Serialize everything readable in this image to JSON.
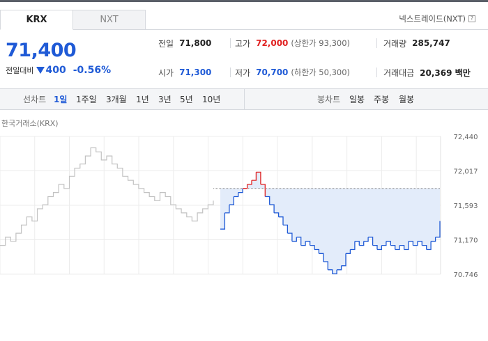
{
  "tabs": [
    {
      "label": "KRX",
      "active": true
    },
    {
      "label": "NXT",
      "active": false
    }
  ],
  "ext_link": {
    "label": "넥스트레이드(NXT)",
    "help_icon": "?"
  },
  "price": {
    "current": "71,400",
    "change_label": "전일대비",
    "direction_icon": "down-triangle-icon",
    "change": "400",
    "change_pct": "-0.56%"
  },
  "stats": {
    "prev_close": {
      "label": "전일",
      "value": "71,800"
    },
    "high": {
      "label": "고가",
      "value": "72,000",
      "limit_text": "(상한가 93,300)"
    },
    "volume": {
      "label": "거래량",
      "value": "285,747"
    },
    "open": {
      "label": "시가",
      "value": "71,300"
    },
    "low": {
      "label": "저가",
      "value": "70,700",
      "limit_text": "(하한가 50,300)"
    },
    "amount": {
      "label": "거래대금",
      "value": "20,369 백만"
    }
  },
  "line_chart_bar": {
    "label": "선차트",
    "periods": [
      "1일",
      "1주일",
      "3개월",
      "1년",
      "3년",
      "5년",
      "10년"
    ],
    "active": "1일"
  },
  "candle_chart_bar": {
    "label": "봉차트",
    "periods": [
      "일봉",
      "주봉",
      "월봉"
    ]
  },
  "colors": {
    "accent_blue": "#1f5ad6",
    "up_red": "#e02020",
    "prev_day_gray": "#c2c2c2",
    "fill_blue": "#e3ecfa"
  },
  "chart_data": {
    "type": "line",
    "title": "한국거래소(KRX)",
    "ylim": [
      70746,
      72440
    ],
    "yticks": [
      "72,440",
      "72,017",
      "71,593",
      "71,170",
      "70,746"
    ],
    "base_value": 71800,
    "series": [
      {
        "values": [
          71100,
          71200,
          71150,
          71250,
          71350,
          71450,
          71400,
          71550,
          71600,
          71700,
          71750,
          71850,
          71800,
          71950,
          72050,
          72100,
          72200,
          72300,
          72250,
          72150,
          72200,
          72100,
          72050,
          71950,
          71900,
          71850,
          71800,
          71750,
          71700,
          71650,
          71750,
          71700,
          71600,
          71550,
          71500,
          71450,
          71400,
          71500,
          71550,
          71600,
          71650
        ]
      },
      {
        "values": [
          71300,
          71500,
          71600,
          71700,
          71750,
          71800,
          71850,
          71900,
          72000,
          71850,
          71700,
          71600,
          71500,
          71450,
          71350,
          71250,
          71150,
          71200,
          71100,
          71150,
          71100,
          71050,
          71000,
          70900,
          70800,
          70750,
          70800,
          70850,
          71000,
          71050,
          71150,
          71100,
          71150,
          71200,
          71100,
          71050,
          71100,
          71150,
          71100,
          71050,
          71100,
          71050,
          71150,
          71100,
          71150,
          71100,
          71050,
          71150,
          71200,
          71400
        ]
      }
    ]
  }
}
